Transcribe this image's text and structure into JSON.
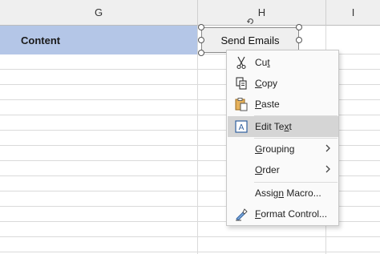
{
  "columns": [
    {
      "name": "G"
    },
    {
      "name": "H"
    },
    {
      "name": "I"
    }
  ],
  "cell_content": "Content",
  "form_control": {
    "label": "Send Emails"
  },
  "context_menu": {
    "items": [
      {
        "pre": "Cu",
        "key": "t",
        "post": "",
        "icon": "scissors-icon"
      },
      {
        "pre": "",
        "key": "C",
        "post": "opy",
        "icon": "copy-icon"
      },
      {
        "pre": "",
        "key": "P",
        "post": "aste",
        "icon": "paste-icon"
      },
      {
        "pre": "Edit Te",
        "key": "x",
        "post": "t",
        "icon": "edit-text-icon",
        "highlighted": true
      },
      {
        "pre": "",
        "key": "G",
        "post": "rouping",
        "icon": "",
        "submenu": true
      },
      {
        "pre": "",
        "key": "O",
        "post": "rder",
        "icon": "",
        "submenu": true
      },
      {
        "pre": "Assig",
        "key": "n",
        "post": " Macro...",
        "icon": ""
      },
      {
        "pre": "",
        "key": "F",
        "post": "ormat Control...",
        "icon": "format-control-icon"
      }
    ]
  }
}
